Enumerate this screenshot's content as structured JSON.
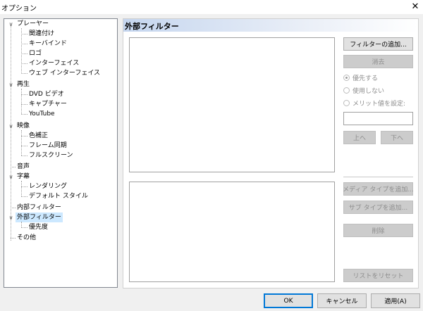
{
  "window": {
    "title": "オプション",
    "close_glyph": "✕"
  },
  "tree": {
    "player": {
      "label": "プレーヤー",
      "children": [
        "関連付け",
        "キーバインド",
        "ロゴ",
        "インターフェイス",
        "ウェブ インターフェイス"
      ]
    },
    "playback": {
      "label": "再生",
      "children": [
        "DVD ビデオ",
        "キャプチャー",
        "YouTube"
      ]
    },
    "video": {
      "label": "映像",
      "children": [
        "色補正",
        "フレーム同期",
        "フルスクリーン"
      ]
    },
    "audio": {
      "label": "音声"
    },
    "subtitles": {
      "label": "字幕",
      "children": [
        "レンダリング",
        "デフォルト スタイル"
      ]
    },
    "internal_filters": {
      "label": "内部フィルター"
    },
    "external_filters": {
      "label": "外部フィルター",
      "children": [
        "優先度"
      ]
    },
    "misc": {
      "label": "その他"
    },
    "expand_glyph": "∨"
  },
  "panel": {
    "title": "外部フィルター",
    "add_filter": "フィルターの追加...",
    "remove": "消去",
    "radio_prefer": "優先する",
    "radio_block": "使用しない",
    "radio_merit": "メリット値を設定:",
    "merit_value": "",
    "up": "上へ",
    "down": "下へ",
    "add_media_type": "メディア タイプを追加...",
    "add_subtype": "サブ タイプを追加...",
    "delete": "削除",
    "reset_list": "リストをリセット"
  },
  "footer": {
    "ok": "OK",
    "cancel": "キャンセル",
    "apply": "適用(A)"
  }
}
